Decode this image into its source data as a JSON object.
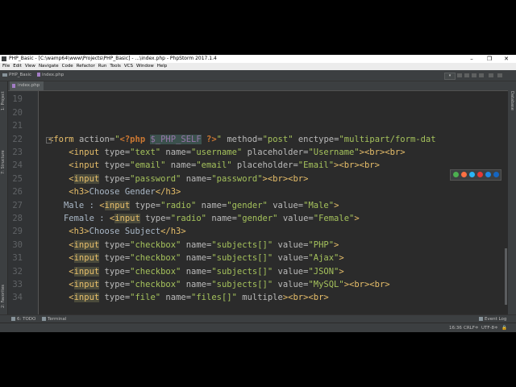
{
  "window": {
    "title": "PHP_Basic - [C:\\wamp64\\www\\Projects\\PHP_Basic] - ...\\index.php - PhpStorm 2017.1.4",
    "minimize": "–",
    "maximize": "❐",
    "close": "✕"
  },
  "menu": [
    "File",
    "Edit",
    "View",
    "Navigate",
    "Code",
    "Refactor",
    "Run",
    "Tools",
    "VCS",
    "Window",
    "Help"
  ],
  "navbar": {
    "project": "PHP_Basic",
    "file": "index.php",
    "run_config": "▾"
  },
  "tool_windows": {
    "left_top": "1: Project",
    "left_mid": "7: Structure",
    "left_bottom": "2: Favorites",
    "right": "Database"
  },
  "editor_tab": {
    "label": "index.php"
  },
  "code_lines": [
    {
      "num": "",
      "tokens": [
        {
          "t": "?>",
          "c": "t-php"
        }
      ]
    },
    {
      "num": "19",
      "tokens": []
    },
    {
      "num": "20",
      "tokens": []
    },
    {
      "num": "21",
      "tokens": []
    },
    {
      "num": "22",
      "tokens": [
        {
          "t": "<form ",
          "c": "t-tag"
        },
        {
          "t": "action=",
          "c": "t-attr"
        },
        {
          "t": "\"",
          "c": "t-str"
        },
        {
          "t": "<?php",
          "c": "t-php"
        },
        {
          "t": " ",
          "c": "t-txt"
        },
        {
          "t": "$_PHP_SELF",
          "c": "t-var"
        },
        {
          "t": " ",
          "c": "t-txt"
        },
        {
          "t": "?>",
          "c": "t-php"
        },
        {
          "t": "\" ",
          "c": "t-str"
        },
        {
          "t": "method=",
          "c": "t-attr"
        },
        {
          "t": "\"post\" ",
          "c": "t-str"
        },
        {
          "t": "enctype=",
          "c": "t-attr"
        },
        {
          "t": "\"multipart/form-dat",
          "c": "t-str"
        }
      ]
    },
    {
      "num": "23",
      "tokens": [
        {
          "t": "    <input ",
          "c": "t-tag"
        },
        {
          "t": "type=",
          "c": "t-attr"
        },
        {
          "t": "\"text\" ",
          "c": "t-str"
        },
        {
          "t": "name=",
          "c": "t-attr"
        },
        {
          "t": "\"username\" ",
          "c": "t-str"
        },
        {
          "t": "placeholder=",
          "c": "t-attr"
        },
        {
          "t": "\"Username\"",
          "c": "t-str"
        },
        {
          "t": "><br><br>",
          "c": "t-tag"
        }
      ]
    },
    {
      "num": "24",
      "tokens": [
        {
          "t": "    <input ",
          "c": "t-tag"
        },
        {
          "t": "type=",
          "c": "t-attr"
        },
        {
          "t": "\"email\" ",
          "c": "t-str"
        },
        {
          "t": "name=",
          "c": "t-attr"
        },
        {
          "t": "\"email\" ",
          "c": "t-str"
        },
        {
          "t": "placeholder=",
          "c": "t-attr"
        },
        {
          "t": "\"Email\"",
          "c": "t-str"
        },
        {
          "t": "><br><br>",
          "c": "t-tag"
        }
      ]
    },
    {
      "num": "25",
      "tokens": [
        {
          "t": "    <",
          "c": "t-tag"
        },
        {
          "t": "input",
          "c": "t-hl"
        },
        {
          "t": " ",
          "c": "t-txt"
        },
        {
          "t": "type=",
          "c": "t-attr"
        },
        {
          "t": "\"password\" ",
          "c": "t-str"
        },
        {
          "t": "name=",
          "c": "t-attr"
        },
        {
          "t": "\"password\"",
          "c": "t-str"
        },
        {
          "t": "><br><br>",
          "c": "t-tag"
        }
      ]
    },
    {
      "num": "26",
      "tokens": [
        {
          "t": "    <h3>",
          "c": "t-tag"
        },
        {
          "t": "Choose Gender",
          "c": "t-txt"
        },
        {
          "t": "</h3>",
          "c": "t-tag"
        }
      ]
    },
    {
      "num": "27",
      "tokens": [
        {
          "t": "   Male : ",
          "c": "t-txt"
        },
        {
          "t": "<",
          "c": "t-tag"
        },
        {
          "t": "input",
          "c": "t-hl"
        },
        {
          "t": " ",
          "c": "t-txt"
        },
        {
          "t": "type=",
          "c": "t-attr"
        },
        {
          "t": "\"radio\" ",
          "c": "t-str"
        },
        {
          "t": "name=",
          "c": "t-attr"
        },
        {
          "t": "\"gender\" ",
          "c": "t-str"
        },
        {
          "t": "value=",
          "c": "t-attr"
        },
        {
          "t": "\"Male\"",
          "c": "t-str"
        },
        {
          "t": ">",
          "c": "t-tag"
        }
      ]
    },
    {
      "num": "28",
      "tokens": [
        {
          "t": "   Female : ",
          "c": "t-txt"
        },
        {
          "t": "<",
          "c": "t-tag"
        },
        {
          "t": "input",
          "c": "t-hl"
        },
        {
          "t": " ",
          "c": "t-txt"
        },
        {
          "t": "type=",
          "c": "t-attr"
        },
        {
          "t": "\"radio\" ",
          "c": "t-str"
        },
        {
          "t": "name=",
          "c": "t-attr"
        },
        {
          "t": "\"gender\" ",
          "c": "t-str"
        },
        {
          "t": "value=",
          "c": "t-attr"
        },
        {
          "t": "\"Female\"",
          "c": "t-str"
        },
        {
          "t": ">",
          "c": "t-tag"
        }
      ]
    },
    {
      "num": "29",
      "tokens": [
        {
          "t": "    <h3>",
          "c": "t-tag"
        },
        {
          "t": "Choose Subject",
          "c": "t-txt"
        },
        {
          "t": "</h3>",
          "c": "t-tag"
        }
      ]
    },
    {
      "num": "30",
      "tokens": [
        {
          "t": "    <",
          "c": "t-tag"
        },
        {
          "t": "input",
          "c": "t-hl"
        },
        {
          "t": " ",
          "c": "t-txt"
        },
        {
          "t": "type=",
          "c": "t-attr"
        },
        {
          "t": "\"checkbox\" ",
          "c": "t-str"
        },
        {
          "t": "name=",
          "c": "t-attr"
        },
        {
          "t": "\"subjects[]\" ",
          "c": "t-str"
        },
        {
          "t": "value=",
          "c": "t-attr"
        },
        {
          "t": "\"PHP\"",
          "c": "t-str"
        },
        {
          "t": ">",
          "c": "t-tag"
        }
      ]
    },
    {
      "num": "31",
      "tokens": [
        {
          "t": "    <",
          "c": "t-tag"
        },
        {
          "t": "input",
          "c": "t-hl"
        },
        {
          "t": " ",
          "c": "t-txt"
        },
        {
          "t": "type=",
          "c": "t-attr"
        },
        {
          "t": "\"checkbox\" ",
          "c": "t-str"
        },
        {
          "t": "name=",
          "c": "t-attr"
        },
        {
          "t": "\"subjects[]\" ",
          "c": "t-str"
        },
        {
          "t": "value=",
          "c": "t-attr"
        },
        {
          "t": "\"Ajax\"",
          "c": "t-str"
        },
        {
          "t": ">",
          "c": "t-tag"
        }
      ]
    },
    {
      "num": "32",
      "tokens": [
        {
          "t": "    <",
          "c": "t-tag"
        },
        {
          "t": "input",
          "c": "t-hl"
        },
        {
          "t": " ",
          "c": "t-txt"
        },
        {
          "t": "type=",
          "c": "t-attr"
        },
        {
          "t": "\"checkbox\" ",
          "c": "t-str"
        },
        {
          "t": "name=",
          "c": "t-attr"
        },
        {
          "t": "\"subjects[]\" ",
          "c": "t-str"
        },
        {
          "t": "value=",
          "c": "t-attr"
        },
        {
          "t": "\"JSON\"",
          "c": "t-str"
        },
        {
          "t": ">",
          "c": "t-tag"
        }
      ]
    },
    {
      "num": "33",
      "tokens": [
        {
          "t": "    <",
          "c": "t-tag"
        },
        {
          "t": "input",
          "c": "t-hl"
        },
        {
          "t": " ",
          "c": "t-txt"
        },
        {
          "t": "type=",
          "c": "t-attr"
        },
        {
          "t": "\"checkbox\" ",
          "c": "t-str"
        },
        {
          "t": "name=",
          "c": "t-attr"
        },
        {
          "t": "\"subjects[]\" ",
          "c": "t-str"
        },
        {
          "t": "value=",
          "c": "t-attr"
        },
        {
          "t": "\"MySQL\"",
          "c": "t-str"
        },
        {
          "t": "><br><br>",
          "c": "t-tag"
        }
      ]
    },
    {
      "num": "34",
      "tokens": [
        {
          "t": "    <",
          "c": "t-tag"
        },
        {
          "t": "input",
          "c": "t-hl"
        },
        {
          "t": " ",
          "c": "t-txt"
        },
        {
          "t": "type=",
          "c": "t-attr"
        },
        {
          "t": "\"file\" ",
          "c": "t-str"
        },
        {
          "t": "name=",
          "c": "t-attr"
        },
        {
          "t": "\"files[]\" ",
          "c": "t-str"
        },
        {
          "t": "multiple",
          "c": "t-attr"
        },
        {
          "t": "><br><br>",
          "c": "t-tag"
        }
      ]
    }
  ],
  "browser_icons": [
    {
      "name": "chrome-icon",
      "color": "#4caf50"
    },
    {
      "name": "firefox-icon",
      "color": "#ff7043"
    },
    {
      "name": "safari-icon",
      "color": "#29b6f6"
    },
    {
      "name": "opera-icon",
      "color": "#e53935"
    },
    {
      "name": "internet-explorer-icon",
      "color": "#1e88e5"
    },
    {
      "name": "edge-icon",
      "color": "#1565c0"
    }
  ],
  "bottom_tools": {
    "todo": "6: TODO",
    "terminal": "Terminal",
    "event_log": "Event Log"
  },
  "status": {
    "position": "16:36",
    "line_sep": "CRLF≑",
    "encoding": "UTF-8≑"
  }
}
